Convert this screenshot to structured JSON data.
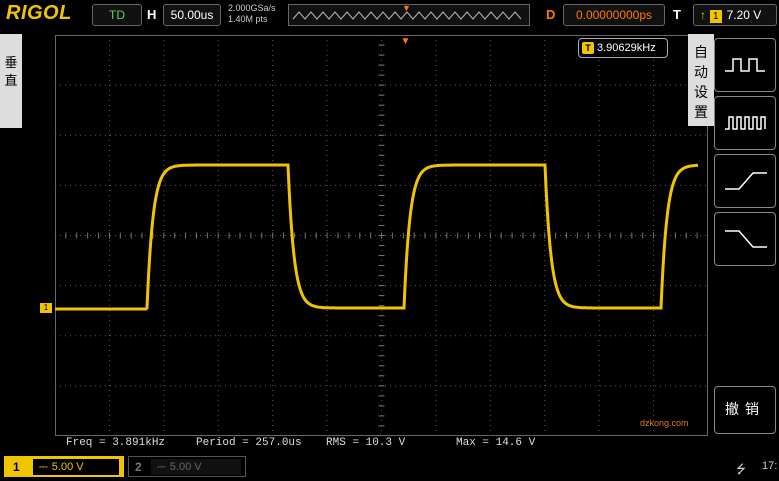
{
  "topbar": {
    "brand": "RIGOL",
    "run_status": "TD",
    "h_label": "H",
    "timebase": "50.00us",
    "sample_rate": "2.000GSa/s",
    "mem_depth": "1.40M pts",
    "d_label": "D",
    "delay": "0.00000000ps",
    "t_label": "T",
    "trigger_level": "7.20 V",
    "trigger_channel": "1"
  },
  "left_tab": {
    "label_1": "垂",
    "label_2": "直"
  },
  "freq_counter": "3.90629kHz",
  "ch1_marker": "1",
  "right_menu": {
    "title_1": "自",
    "title_2": "动",
    "title_3": "设",
    "title_4": "置",
    "undo_label": "撤销"
  },
  "measurements": {
    "freq": "Freq = 3.891kHz",
    "period": "Period = 257.0us",
    "rms": "RMS = 10.3 V",
    "max": "Max = 14.6 V"
  },
  "bottom": {
    "ch1_num": "1",
    "ch1_scale": "5.00 V",
    "ch2_num": "2",
    "ch2_scale": "5.00 V",
    "clock": "17:",
    "watermark": "dzkong.com"
  },
  "colors": {
    "ch1": "#f1c400",
    "accent": "#ff7a00",
    "grid": "#5a5a5a"
  }
}
